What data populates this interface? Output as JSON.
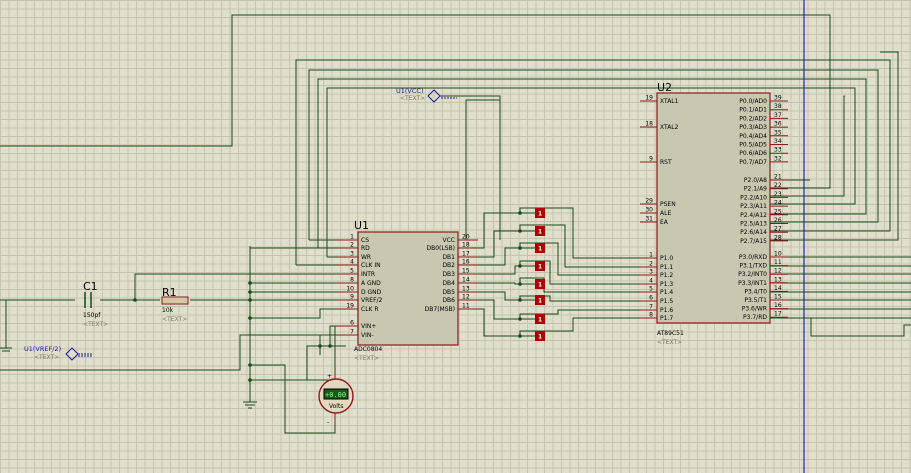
{
  "components": {
    "c1": {
      "ref": "C1",
      "value": "150pf",
      "text": "<TEXT>"
    },
    "r1": {
      "ref": "R1",
      "value": "10k",
      "text": "<TEXT>"
    },
    "u1": {
      "ref": "U1",
      "part": "ADC0804",
      "text": "<TEXT>",
      "left_pins": [
        {
          "num": "1",
          "name": "CS"
        },
        {
          "num": "2",
          "name": "RD"
        },
        {
          "num": "3",
          "name": "WR"
        },
        {
          "num": "4",
          "name": "CLK IN"
        },
        {
          "num": "5",
          "name": "INTR"
        },
        {
          "num": "8",
          "name": "A GND"
        },
        {
          "num": "10",
          "name": "D GND"
        },
        {
          "num": "9",
          "name": "VREF/2"
        },
        {
          "num": "19",
          "name": "CLK R"
        },
        {
          "num": "6",
          "name": "VIN+"
        },
        {
          "num": "7",
          "name": "VIN-"
        }
      ],
      "right_pins": [
        {
          "num": "20",
          "name": "VCC"
        },
        {
          "num": "18",
          "name": "DB0(LSB)"
        },
        {
          "num": "17",
          "name": "DB1"
        },
        {
          "num": "16",
          "name": "DB2"
        },
        {
          "num": "15",
          "name": "DB3"
        },
        {
          "num": "14",
          "name": "DB4"
        },
        {
          "num": "13",
          "name": "DB5"
        },
        {
          "num": "12",
          "name": "DB6"
        },
        {
          "num": "11",
          "name": "DB7(MSB)"
        }
      ]
    },
    "u2": {
      "ref": "U2",
      "part": "AT89C51",
      "text": "<TEXT>",
      "left_pins": [
        {
          "num": "19",
          "name": "XTAL1"
        },
        {
          "num": "18",
          "name": "XTAL2"
        },
        {
          "num": "9",
          "name": "RST"
        },
        {
          "num": "29",
          "name": "PSEN"
        },
        {
          "num": "30",
          "name": "ALE"
        },
        {
          "num": "31",
          "name": "EA"
        },
        {
          "num": "1",
          "name": "P1.0"
        },
        {
          "num": "2",
          "name": "P1.1"
        },
        {
          "num": "3",
          "name": "P1.2"
        },
        {
          "num": "4",
          "name": "P1.3"
        },
        {
          "num": "5",
          "name": "P1.4"
        },
        {
          "num": "6",
          "name": "P1.5"
        },
        {
          "num": "7",
          "name": "P1.6"
        },
        {
          "num": "8",
          "name": "P1.7"
        }
      ],
      "right_pins": [
        {
          "num": "39",
          "name": "P0.0/AD0"
        },
        {
          "num": "38",
          "name": "P0.1/AD1"
        },
        {
          "num": "37",
          "name": "P0.2/AD2"
        },
        {
          "num": "36",
          "name": "P0.3/AD3"
        },
        {
          "num": "35",
          "name": "P0.4/AD4"
        },
        {
          "num": "34",
          "name": "P0.5/AD5"
        },
        {
          "num": "33",
          "name": "P0.6/AD6"
        },
        {
          "num": "32",
          "name": "P0.7/AD7"
        },
        {
          "num": "21",
          "name": "P2.0/A8"
        },
        {
          "num": "22",
          "name": "P2.1/A9"
        },
        {
          "num": "23",
          "name": "P2.2/A10"
        },
        {
          "num": "24",
          "name": "P2.3/A11"
        },
        {
          "num": "25",
          "name": "P2.4/A12"
        },
        {
          "num": "26",
          "name": "P2.5/A13"
        },
        {
          "num": "27",
          "name": "P2.6/A14"
        },
        {
          "num": "28",
          "name": "P2.7/A15"
        },
        {
          "num": "10",
          "name": "P3.0/RXD"
        },
        {
          "num": "11",
          "name": "P3.1/TXD"
        },
        {
          "num": "12",
          "name": "P3.2/INT0"
        },
        {
          "num": "13",
          "name": "P3.3/INT1"
        },
        {
          "num": "14",
          "name": "P3.4/T0"
        },
        {
          "num": "15",
          "name": "P3.5/T1"
        },
        {
          "num": "16",
          "name": "P3.6/WR"
        },
        {
          "num": "17",
          "name": "P3.7/RD"
        }
      ]
    }
  },
  "terminals": {
    "vcc": {
      "label": "U1(VCC)",
      "text": "<TEXT>"
    },
    "vref": {
      "label": "U1(VREF/2)",
      "text": "<TEXT>"
    }
  },
  "voltmeter": {
    "reading": "+0.00",
    "unit": "Volts",
    "plus": "+",
    "minus": "-"
  },
  "probes": {
    "label": "1",
    "count": 8
  }
}
